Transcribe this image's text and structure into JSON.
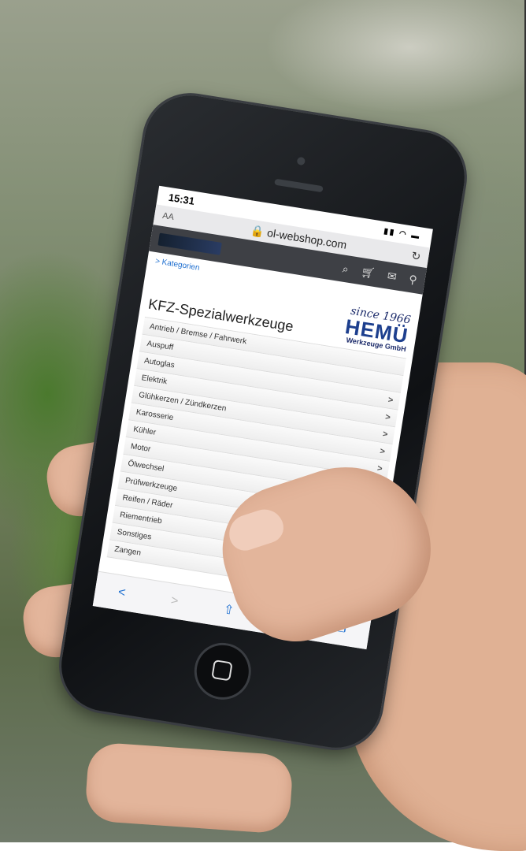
{
  "status_bar": {
    "time": "15:31",
    "signal_icons": "signal-wifi-battery"
  },
  "browser": {
    "aa_label": "AA",
    "url": "ol-webshop.com",
    "reload_icon": "reload-icon"
  },
  "shop_header": {
    "icons": [
      "search-icon",
      "cart-icon",
      "mail-icon",
      "location-icon"
    ]
  },
  "breadcrumb": "> Kategorien",
  "page_title": "KFZ-Spezialwerkzeuge",
  "brand": {
    "since": "since 1966",
    "name": "HEMÜ",
    "subtitle": "Werkzeuge GmbH"
  },
  "categories": [
    {
      "label": "Antrieb / Bremse / Fahrwerk",
      "chevron": ""
    },
    {
      "label": "Auspuff",
      "chevron": ""
    },
    {
      "label": "Autoglas",
      "chevron": ">"
    },
    {
      "label": "Elektrik",
      "chevron": ">"
    },
    {
      "label": "Glühkerzen / Zündkerzen",
      "chevron": ">"
    },
    {
      "label": "Karosserie",
      "chevron": ">"
    },
    {
      "label": "Kühler",
      "chevron": ">"
    },
    {
      "label": "Motor",
      "chevron": ">"
    },
    {
      "label": "Ölwechsel",
      "chevron": ">"
    },
    {
      "label": "Prüfwerkzeuge",
      "chevron": ""
    },
    {
      "label": "Reifen / Räder",
      "chevron": ""
    },
    {
      "label": "Riementrieb",
      "chevron": ""
    },
    {
      "label": "Sonstiges",
      "chevron": ""
    },
    {
      "label": "Zangen",
      "chevron": ">"
    }
  ],
  "toolbar": {
    "back": "<",
    "forward": ">",
    "share": "⇧",
    "bookmarks": "⊞",
    "tabs": "❐"
  },
  "colors": {
    "link": "#1e6fd0",
    "brand": "#1d3f8e",
    "header": "#3e4045"
  }
}
